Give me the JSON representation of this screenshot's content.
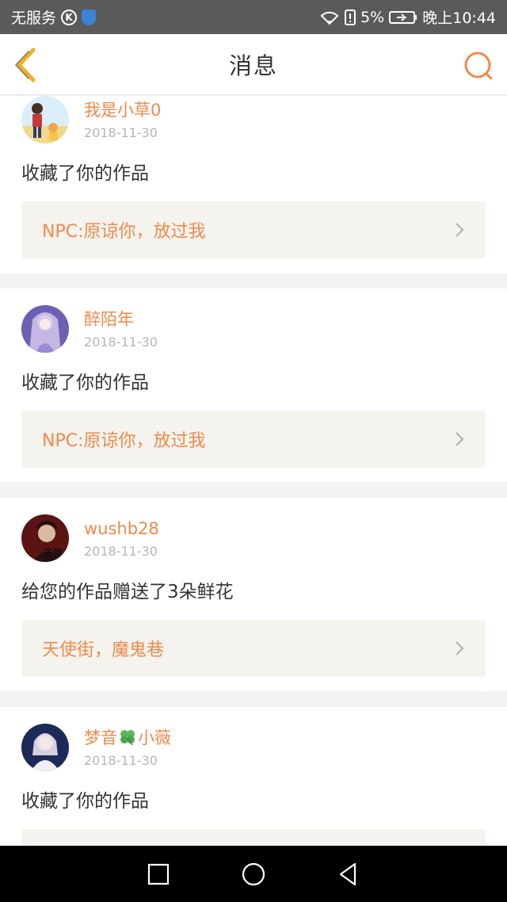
{
  "status_bar": {
    "carrier": "无服务",
    "k_badge": "K",
    "battery": "5%",
    "time": "晚上10:44"
  },
  "header": {
    "title": "消息"
  },
  "messages": [
    {
      "username": "我是小草0",
      "date": "2018-11-30",
      "action": "收藏了你的作品",
      "work_title": "NPC:原谅你，放过我",
      "avatar_colors": [
        "#7fb4e5",
        "#f2c34a"
      ]
    },
    {
      "username": "醉陌年",
      "date": "2018-11-30",
      "action": "收藏了你的作品",
      "work_title": "NPC:原谅你，放过我",
      "avatar_colors": [
        "#8a7cc7",
        "#d6c6ea"
      ]
    },
    {
      "username": "wushb28",
      "date": "2018-11-30",
      "action": "给您的作品赠送了3朵鲜花",
      "work_title": "天使街，魔鬼巷",
      "avatar_colors": [
        "#7a1f1f",
        "#d9b9a0"
      ],
      "avatar_text": "天使"
    },
    {
      "username_prefix": "梦音",
      "username_suffix": "小薇",
      "date": "2018-11-30",
      "action": "收藏了你的作品",
      "work_title": "",
      "avatar_colors": [
        "#1c2a5a",
        "#efe8ef"
      ]
    }
  ],
  "colors": {
    "accent": "#f08a4b",
    "back_icon": "#f2b01e",
    "divider_bg": "#f5f3f1"
  },
  "icons": {
    "back": "chevron-left-icon",
    "search": "search-icon",
    "clover": "four-leaf-clover-icon",
    "nav_recent": "square-icon",
    "nav_home": "circle-icon",
    "nav_back": "triangle-back-icon"
  }
}
